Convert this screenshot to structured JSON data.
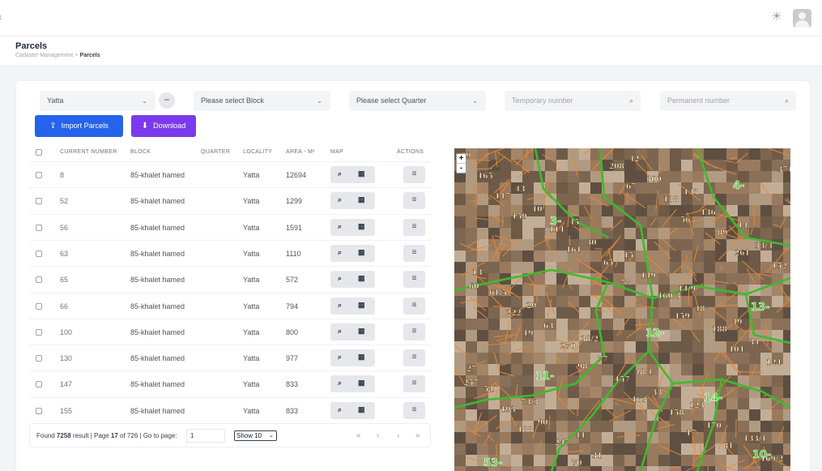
{
  "header": {
    "back_icon": "chevron-left-icon",
    "theme_icon": "sun-icon",
    "avatar_icon": "user-avatar-icon"
  },
  "page": {
    "title": "Parcels",
    "breadcrumb": [
      "Cadaster Management",
      "Parcels"
    ]
  },
  "filters": {
    "locality": "Yatta",
    "block_placeholder": "Please select Block",
    "quarter_placeholder": "Please select Quarter",
    "temporary_placeholder": "Temporary number",
    "permanent_placeholder": "Permanent number"
  },
  "actions": {
    "import_label": "Import Parcels",
    "download_label": "Download"
  },
  "table": {
    "columns": [
      "CURRENT NUMBER",
      "BLOCK",
      "QUARTER",
      "LOCALITY",
      "AREA - M²",
      "MAP",
      "ACTIONS"
    ],
    "rows": [
      {
        "number": "8",
        "block": "85-khalet hamed",
        "quarter": "",
        "locality": "Yatta",
        "area": "12694"
      },
      {
        "number": "52",
        "block": "85-khalet hamed",
        "quarter": "",
        "locality": "Yatta",
        "area": "1299"
      },
      {
        "number": "56",
        "block": "85-khalet hamed",
        "quarter": "",
        "locality": "Yatta",
        "area": "1591"
      },
      {
        "number": "63",
        "block": "85-khalet hamed",
        "quarter": "",
        "locality": "Yatta",
        "area": "1110"
      },
      {
        "number": "65",
        "block": "85-khalet hamed",
        "quarter": "",
        "locality": "Yatta",
        "area": "572"
      },
      {
        "number": "66",
        "block": "85-khalet hamed",
        "quarter": "",
        "locality": "Yatta",
        "area": "794"
      },
      {
        "number": "100",
        "block": "85-khalet hamed",
        "quarter": "",
        "locality": "Yatta",
        "area": "800"
      },
      {
        "number": "130",
        "block": "85-khalet hamed",
        "quarter": "",
        "locality": "Yatta",
        "area": "977"
      },
      {
        "number": "147",
        "block": "85-khalet hamed",
        "quarter": "",
        "locality": "Yatta",
        "area": "833"
      },
      {
        "number": "155",
        "block": "85-khalet hamed",
        "quarter": "",
        "locality": "Yatta",
        "area": "833"
      }
    ]
  },
  "pagination": {
    "found_prefix": "Found ",
    "total": "7258",
    "result_page": " result | Page ",
    "current_page": "17",
    "of_pages": " of 726 | Go to page:",
    "goto_value": "1",
    "show_value": "Show 10",
    "nav": [
      "«",
      "‹",
      "›",
      "»"
    ]
  },
  "map": {
    "zoom_in": "+",
    "zoom_out": "-",
    "block_labels": [
      "3-",
      "4-",
      "12-",
      "13-",
      "11-",
      "14-",
      "10-",
      "53-"
    ],
    "parcel_labels": [
      "39",
      "43",
      "45",
      "15",
      "14/9",
      "49",
      "27",
      "73/3",
      "44",
      "42",
      "133",
      "14",
      "13",
      "29",
      "38/2",
      "48/1",
      "123",
      "133/1",
      "165",
      "10",
      "30",
      "149",
      "48",
      "34",
      "54",
      "90",
      "31",
      "300",
      "136",
      "33/3",
      "61/5",
      "63",
      "77",
      "33",
      "170",
      "169/2",
      "147",
      "114",
      "65",
      "160/3",
      "188",
      "124",
      "193",
      "247",
      "208",
      "138",
      "89",
      "152",
      "222",
      "270",
      "157",
      "158",
      "81",
      "371",
      "159",
      "161",
      "77",
      "159",
      "104",
      "257",
      "188",
      "70",
      "67",
      "56",
      "261",
      "60",
      "19",
      "98",
      "163",
      "17"
    ]
  },
  "colors": {
    "primary": "#2563eb",
    "download": "#7c3aed",
    "parcel_orange": "#e38a3a",
    "block_boundary": "#3dbb2c"
  }
}
